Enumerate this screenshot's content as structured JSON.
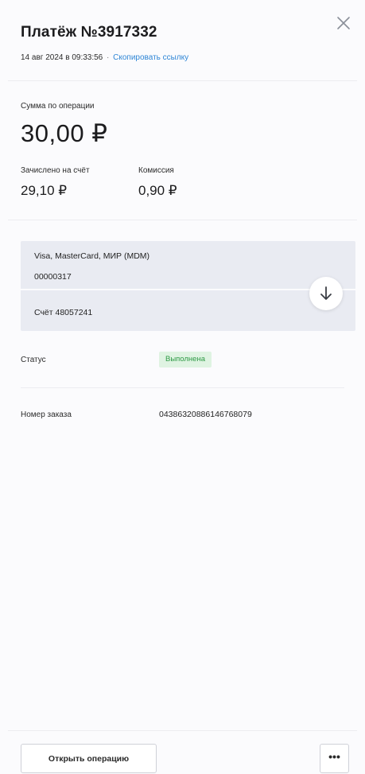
{
  "header": {
    "title": "Платёж №3917332",
    "date": "14 авг 2024 в 09:33:56",
    "separator": "·",
    "copy_link": "Скопировать ссылку",
    "close_icon": "close-icon"
  },
  "amount": {
    "label": "Сумма по операции",
    "value": "30,00 ₽",
    "credited_label": "Зачислено на счёт",
    "credited_value": "29,10 ₽",
    "fee_label": "Комиссия",
    "fee_value": "0,90 ₽"
  },
  "route": {
    "source_name": "Visa, MasterCard, МИР (MDM)",
    "source_id": "00000317",
    "destination": "Счёт 48057241",
    "arrow_icon": "arrow-down-icon"
  },
  "details": {
    "status_label": "Статус",
    "status_value": "Выполнена",
    "status_color": "#2e9a45",
    "order_label": "Номер заказа",
    "order_value": "04386320886146768079"
  },
  "footer": {
    "open_button": "Открыть операцию",
    "more_button": "•••"
  }
}
